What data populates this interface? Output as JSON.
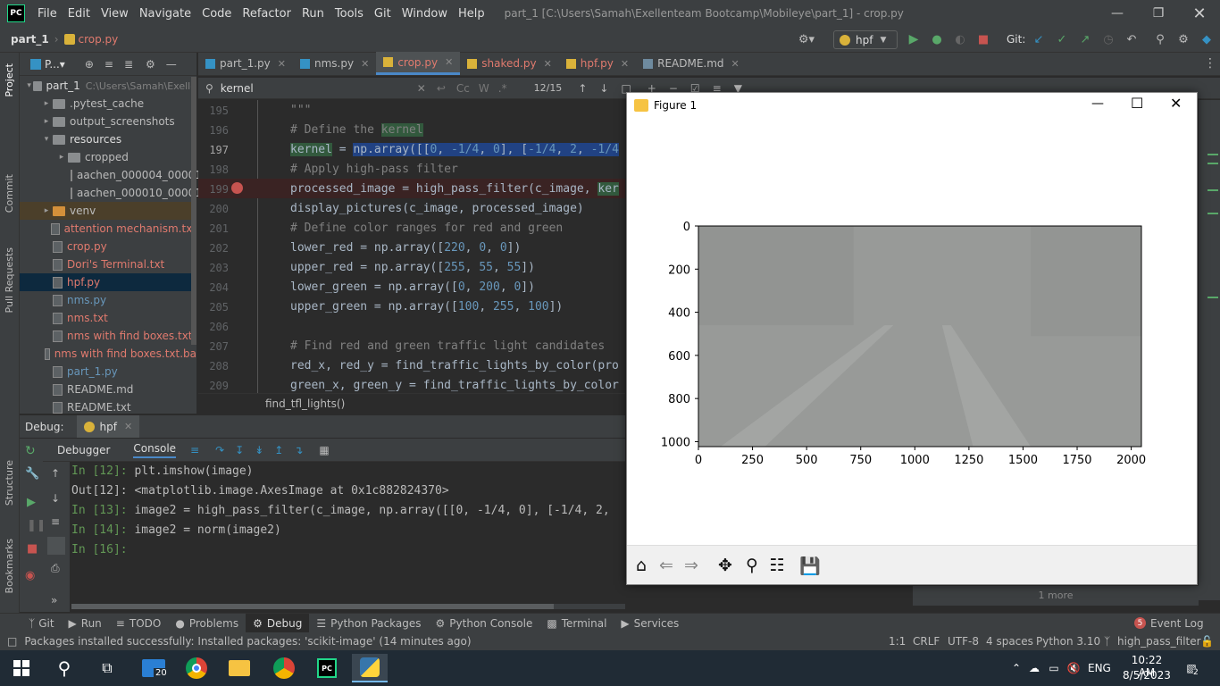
{
  "menubar": {
    "logo": "PC",
    "items": [
      "File",
      "Edit",
      "View",
      "Navigate",
      "Code",
      "Refactor",
      "Run",
      "Tools",
      "Git",
      "Window",
      "Help"
    ],
    "title": "part_1 [C:\\Users\\Samah\\Exellenteam Bootcamp\\Mobileye\\part_1] - crop.py"
  },
  "navbar": {
    "project": "part_1",
    "file": "crop.py",
    "run_config": "hpf",
    "git_label": "Git:"
  },
  "project_panel": {
    "header": "P...▾",
    "items": [
      {
        "label": "part_1",
        "extra": "C:\\Users\\Samah\\Exelle",
        "type": "folder-open",
        "depth": 0
      },
      {
        "label": ".pytest_cache",
        "type": "folder",
        "depth": 1
      },
      {
        "label": "output_screenshots",
        "type": "folder",
        "depth": 1
      },
      {
        "label": "resources",
        "type": "folder-open",
        "depth": 1
      },
      {
        "label": "cropped",
        "type": "folder",
        "depth": 2
      },
      {
        "label": "aachen_000004_000019",
        "type": "file",
        "depth": 3
      },
      {
        "label": "aachen_000010_000019",
        "type": "file",
        "depth": 3
      },
      {
        "label": "venv",
        "type": "folder-excl",
        "depth": 1
      },
      {
        "label": "attention mechanism.txt",
        "type": "file-red",
        "depth": 1
      },
      {
        "label": "crop.py",
        "type": "file-red",
        "depth": 1
      },
      {
        "label": "Dori's Terminal.txt",
        "type": "file-red",
        "depth": 1
      },
      {
        "label": "hpf.py",
        "type": "file-red",
        "depth": 1
      },
      {
        "label": "nms.py",
        "type": "file-blue",
        "depth": 1
      },
      {
        "label": "nms.txt",
        "type": "file-red",
        "depth": 1
      },
      {
        "label": "nms with find boxes.txt",
        "type": "file-red",
        "depth": 1
      },
      {
        "label": "nms with find boxes.txt.ba",
        "type": "file-red",
        "depth": 1
      },
      {
        "label": "part_1.py",
        "type": "file-blue",
        "depth": 1
      },
      {
        "label": "README.md",
        "type": "file",
        "depth": 1
      },
      {
        "label": "README.txt",
        "type": "file",
        "depth": 1
      }
    ]
  },
  "tabs": [
    {
      "label": "part_1.py",
      "active": false
    },
    {
      "label": "nms.py",
      "active": false
    },
    {
      "label": "crop.py",
      "active": true
    },
    {
      "label": "shaked.py",
      "active": false
    },
    {
      "label": "hpf.py",
      "active": false
    },
    {
      "label": "README.md",
      "active": false
    }
  ],
  "search": {
    "query": "kernel",
    "match_case": "Cc",
    "words": "W",
    "regex": ".*",
    "count": "12/15"
  },
  "code": {
    "lines": [
      {
        "n": "195",
        "text": "\"\"\""
      },
      {
        "n": "196",
        "text": "# Define the kernel"
      },
      {
        "n": "197",
        "text": "kernel = np.array([[0, -1/4, 0], [-1/4, 2, -1/4"
      },
      {
        "n": "198",
        "text": "# Apply high-pass filter"
      },
      {
        "n": "199",
        "text": "processed_image = high_pass_filter(c_image, ker"
      },
      {
        "n": "200",
        "text": "display_pictures(c_image, processed_image)"
      },
      {
        "n": "201",
        "text": "# Define color ranges for red and green"
      },
      {
        "n": "202",
        "text": "lower_red = np.array([220, 0, 0])"
      },
      {
        "n": "203",
        "text": "upper_red = np.array([255, 55, 55])"
      },
      {
        "n": "204",
        "text": "lower_green = np.array([0, 200, 0])"
      },
      {
        "n": "205",
        "text": "upper_green = np.array([100, 255, 100])"
      },
      {
        "n": "206",
        "text": ""
      },
      {
        "n": "207",
        "text": "# Find red and green traffic light candidates"
      },
      {
        "n": "208",
        "text": "red_x, red_y = find_traffic_lights_by_color(pro"
      },
      {
        "n": "209",
        "text": "green_x, green_y = find_traffic_lights_by_color"
      }
    ],
    "breadcrumb": "find_tfl_lights()"
  },
  "debug": {
    "label": "Debug:",
    "config": "hpf",
    "tabs": [
      "Debugger",
      "Console"
    ],
    "console": [
      {
        "prompt": "In [12]:",
        "text": "plt.imshow(image)"
      },
      {
        "prompt": "Out[12]:",
        "text": "<matplotlib.image.AxesImage at 0x1c882824370>"
      },
      {
        "prompt": "In [13]:",
        "text": "image2 = high_pass_filter(c_image, np.array([[0, -1/4, 0], [-1/4, 2,"
      },
      {
        "prompt": "In [14]:",
        "text": "image2 = norm(image2)"
      },
      {
        "prompt": "In [16]:",
        "text": ""
      }
    ],
    "more": "1 more"
  },
  "figure": {
    "title": "Figure 1",
    "toolbar": [
      "home-icon",
      "back-icon",
      "forward-icon",
      "pan-icon",
      "zoom-icon",
      "configure-icon",
      "save-icon"
    ]
  },
  "chart_data": {
    "type": "image",
    "title": "",
    "xlabel": "",
    "ylabel": "",
    "xlim": [
      0,
      2047
    ],
    "ylim": [
      1023,
      0
    ],
    "xticks": [
      "0",
      "250",
      "500",
      "750",
      "1000",
      "1250",
      "1500",
      "1750",
      "2000"
    ],
    "yticks": [
      "0",
      "200",
      "400",
      "600",
      "800",
      "1000"
    ],
    "xtick_values": [
      0,
      250,
      500,
      750,
      1000,
      1250,
      1500,
      1750,
      2000
    ],
    "ytick_values": [
      0,
      200,
      400,
      600,
      800,
      1000
    ],
    "image_tint": "#989a98"
  },
  "toolwindows": [
    "Git",
    "Run",
    "TODO",
    "Problems",
    "Debug",
    "Python Packages",
    "Python Console",
    "Terminal",
    "Services"
  ],
  "event_log": {
    "count": "5",
    "label": "Event Log"
  },
  "status": {
    "message": "Packages installed successfully: Installed packages: 'scikit-image' (14 minutes ago)",
    "position": "1:1",
    "line_sep": "CRLF",
    "encoding": "UTF-8",
    "indent": "4 spaces",
    "interpreter": "Python 3.10",
    "branch": "high_pass_filter"
  },
  "taskbar": {
    "mail_badge": "20",
    "time": "10:22 AM",
    "date": "8/5/2023",
    "lang": "ENG",
    "notif_count": "2"
  },
  "side_labels": {
    "project": "Project",
    "commit": "Commit",
    "pull_requests": "Pull Requests",
    "structure": "Structure",
    "bookmarks": "Bookmarks"
  }
}
